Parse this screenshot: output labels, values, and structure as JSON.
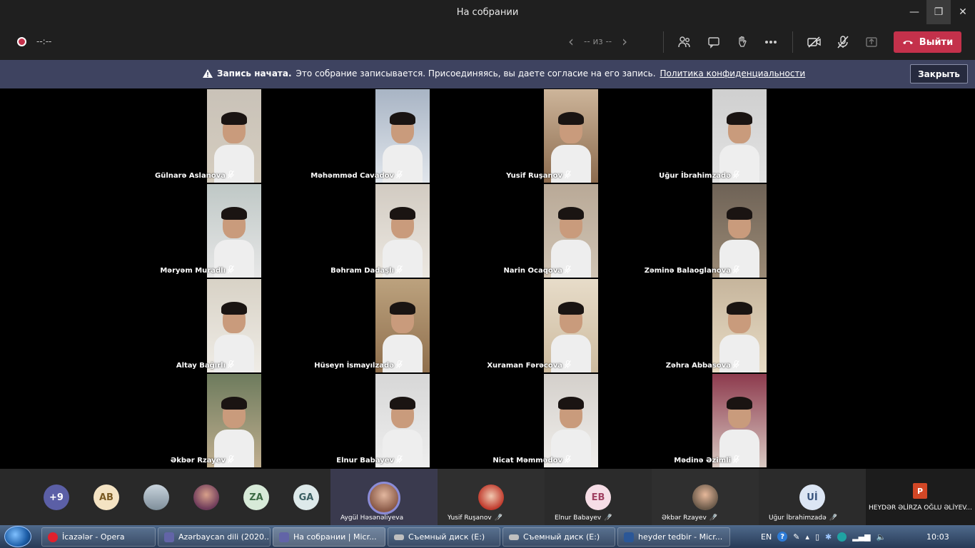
{
  "window": {
    "title": "На собрании",
    "minimize": "—",
    "maximize": "❐",
    "close": "✕"
  },
  "toolbar": {
    "record_time": "--:--",
    "pager_prev": "‹",
    "pager_label": "-- из --",
    "pager_next": "›",
    "icons": {
      "participants": "people-icon",
      "chat": "chat-icon",
      "raise_hand": "hand-icon",
      "more": "more-icon",
      "camera": "camera-off-icon",
      "mic": "mic-off-icon",
      "share": "share-tray-icon"
    },
    "leave_label": "Выйти"
  },
  "banner": {
    "bold": "Запись начата.",
    "text": "Это собрание записывается. Присоединяясь, вы даете согласие на его запись.",
    "link": "Политика конфиденциальности",
    "close_label": "Закрыть"
  },
  "grid": [
    {
      "name": "Gülnarə Aslanova"
    },
    {
      "name": "Məhəmməd Cavadov"
    },
    {
      "name": "Yusif Ruşanov"
    },
    {
      "name": "Uğur İbrahimzadə"
    },
    {
      "name": "Məryəm Muradlı"
    },
    {
      "name": "Bəhram Dadaşlı"
    },
    {
      "name": "Narin Ocaqova"
    },
    {
      "name": "Zəminə Balaoglanova"
    },
    {
      "name": "Altay Bağırlı"
    },
    {
      "name": "Hüseyn İsmayılzadə"
    },
    {
      "name": "Xuraman Fərəcova"
    },
    {
      "name": "Zəhra Abbasova"
    },
    {
      "name": "Əkbər Rzayev"
    },
    {
      "name": "Elnur Babayev"
    },
    {
      "name": "Nicat Məmmədov"
    },
    {
      "name": "Mədinə Əzimli"
    }
  ],
  "strip": {
    "overflow": "+9",
    "initials": [
      "AB",
      "ZA",
      "GA"
    ],
    "named": [
      {
        "name": "Aygül Həsənəliyeva"
      },
      {
        "name": "Yusif Ruşanov"
      },
      {
        "name": "Elnur Babayev",
        "initials": "EB"
      },
      {
        "name": "Əkbər Rzayev"
      },
      {
        "name": "Uğur İbrahimzadə",
        "initials": "Uİ"
      }
    ],
    "shared_file": "HEYDƏR ƏLİRZA OĞLU ƏLİYEV..."
  },
  "taskbar": {
    "items": [
      "İcazələr - Opera",
      "Azərbaycan dili (2020...",
      "На собрании | Micr...",
      "Съемный диск (E:)",
      "Съемный диск (E:)",
      "heyder tedbir - Micr..."
    ],
    "lang": "EN",
    "clock": "10:03"
  },
  "colors": {
    "leave": "#c4314b",
    "banner": "#3e4360",
    "strip": "#292929",
    "accent": "#6264a7"
  }
}
